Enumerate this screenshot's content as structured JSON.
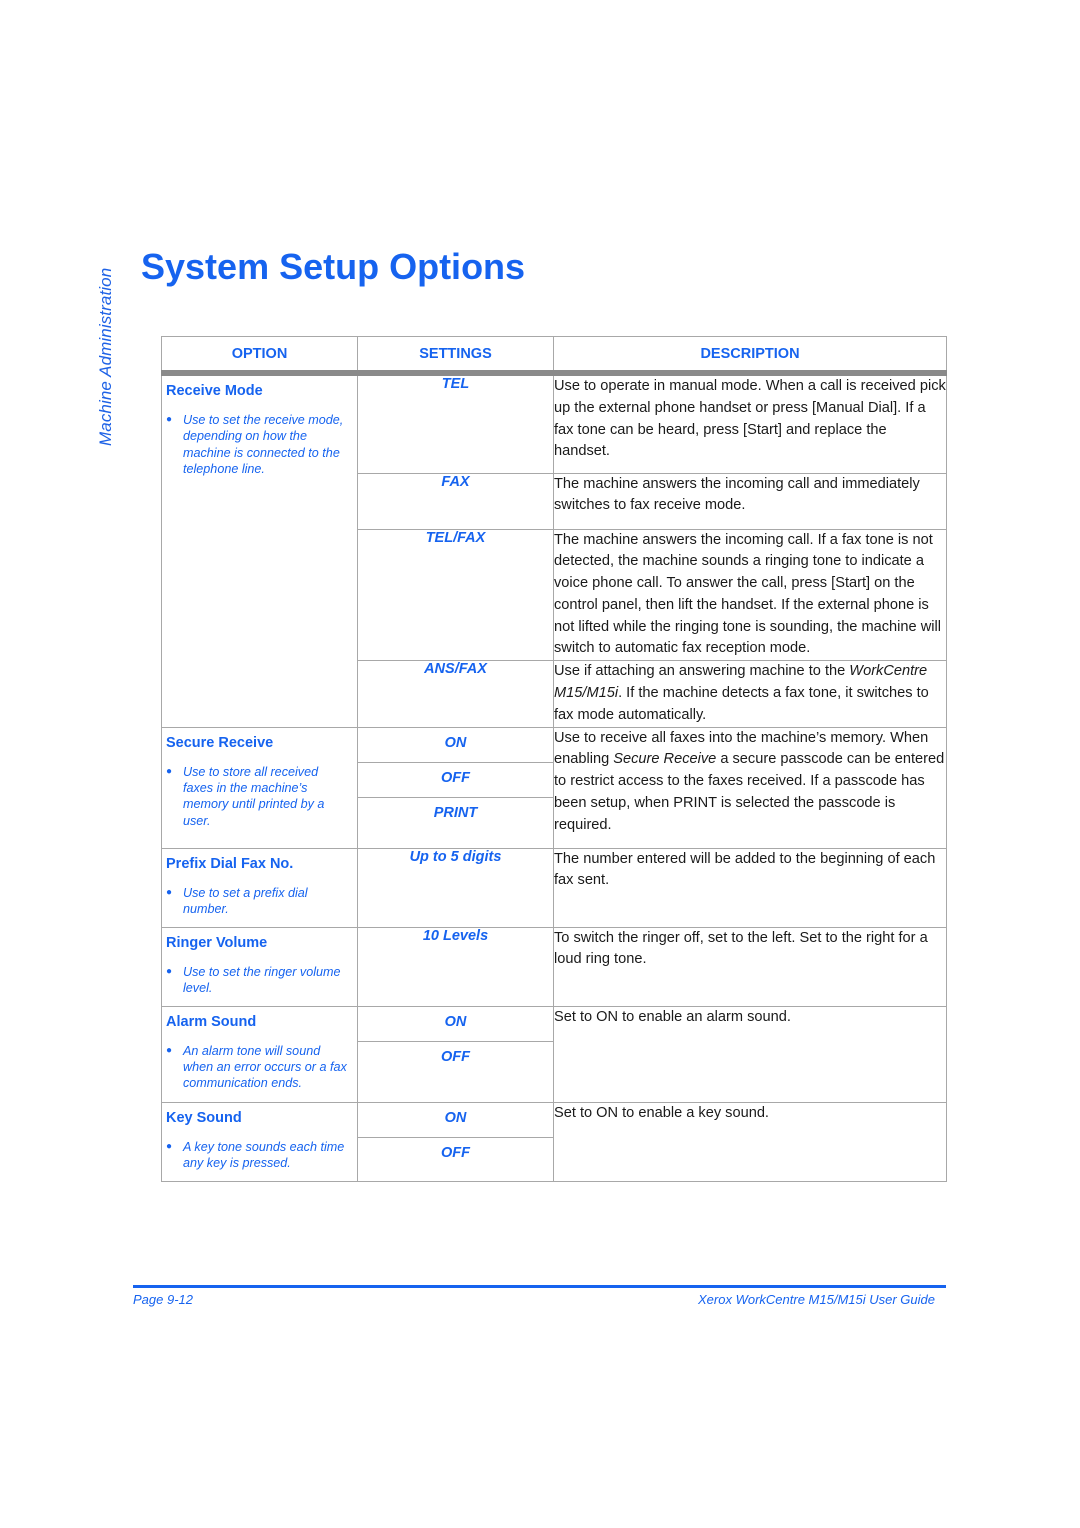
{
  "side_label": "Machine Administration",
  "page_title": "System Setup Options",
  "table": {
    "headers": [
      "OPTION",
      "SETTINGS",
      "DESCRIPTION"
    ],
    "rows": [
      {
        "option": "Receive Mode",
        "note": "Use to set the receive mode, depending on how the machine is connected to the telephone line.",
        "settings": [
          {
            "value": "TEL",
            "description": "Use to operate in manual mode. When a call is received pick up the external phone handset or press [Manual Dial]. If a fax tone can be heard, press [Start] and replace the handset."
          },
          {
            "value": "FAX",
            "description": "The machine answers the incoming call and immediately switches to fax receive mode."
          },
          {
            "value": "TEL/FAX",
            "description": "The machine answers the incoming call. If a fax tone is not detected, the machine sounds a ringing tone to indicate a voice phone call. To answer the call, press [Start] on the control panel, then lift the handset. If the external phone is not lifted while the ringing tone is sounding, the machine will switch to automatic fax reception mode."
          },
          {
            "value": "ANS/FAX",
            "description_pre": "Use if attaching an answering machine to the ",
            "description_em": "WorkCentre M15/M15i",
            "description_post": ". If the machine detects a fax tone, it switches to fax mode automatically."
          }
        ]
      },
      {
        "option": "Secure Receive",
        "note": "Use to store all received faxes in the machine’s memory until printed by a user.",
        "settings": [
          "ON",
          "OFF",
          "PRINT"
        ],
        "description_pre": "Use to receive all faxes into the machine’s memory. When enabling ",
        "description_em": "Secure Receive",
        "description_post": " a secure passcode can be entered to restrict access to the faxes received.  If a passcode has been setup, when PRINT is selected the passcode is required."
      },
      {
        "option": "Prefix Dial Fax No.",
        "note": "Use to set a prefix dial number.",
        "settings": [
          "Up to 5 digits"
        ],
        "description": "The number entered will be added to the beginning of each fax sent."
      },
      {
        "option": "Ringer Volume",
        "note": "Use to set the ringer volume level.",
        "settings": [
          "10 Levels"
        ],
        "description": "To switch the ringer off, set to the left. Set to the right for a loud ring tone."
      },
      {
        "option": "Alarm Sound",
        "note": "An alarm tone will sound when an error occurs or a fax communication ends.",
        "settings": [
          "ON",
          "OFF"
        ],
        "description": "Set to ON to enable an alarm sound."
      },
      {
        "option": "Key Sound",
        "note": "A key tone sounds each time any key is pressed.",
        "settings": [
          "ON",
          "OFF"
        ],
        "description": "Set to ON to enable a key sound."
      }
    ]
  },
  "bullet_glyph": "●",
  "footer": {
    "page": "Page 9-12",
    "guide": "Xerox WorkCentre M15/M15i User Guide"
  },
  "colors": {
    "accent": "#1663ef",
    "rule": "#a8a8a8"
  }
}
